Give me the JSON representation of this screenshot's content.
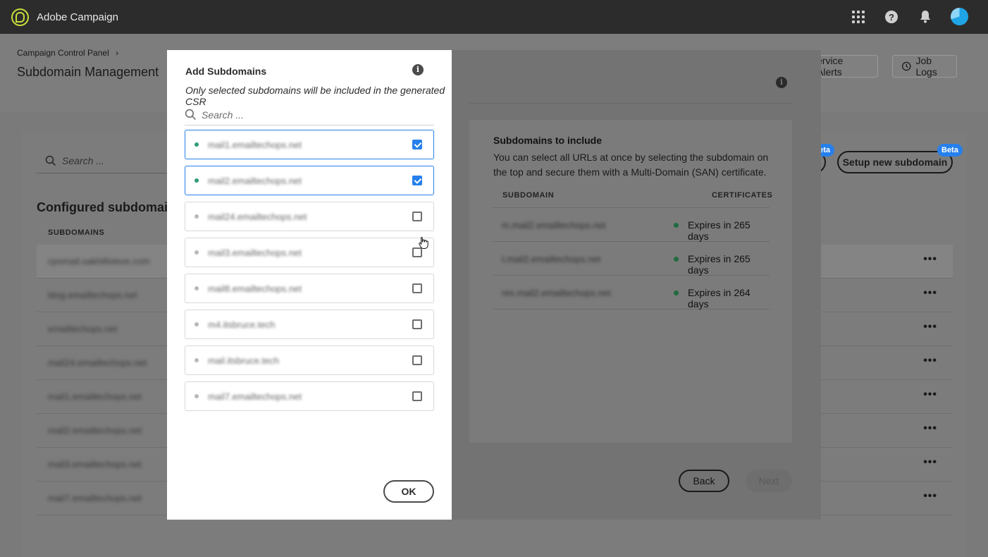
{
  "app": {
    "title": "Adobe Campaign"
  },
  "header": {
    "breadcrumb": "Campaign Control Panel",
    "page_title": "Subdomain Management",
    "service_alerts_label": "ervice Alerts",
    "job_logs_label": "Job Logs"
  },
  "background": {
    "search_placeholder": "Search ...",
    "configured_title": "Configured subdomains",
    "col_subdomains": "SUBDOMAINS",
    "rows": [
      "cpomail.oakhillsteve.com",
      "blog.emailtechops.net",
      "emailtechops.net",
      "mail24.emailtechops.net",
      "mail1.emailtechops.net",
      "mail2.emailtechops.net",
      "mail3.emailtechops.net",
      "mail7.emailtechops.net"
    ],
    "more_label": "•••",
    "setup_label": "Setup new subdomain",
    "beta_label": "Beta",
    "beta_partial_label": "eta"
  },
  "wizard": {
    "include_title": "Subdomains to include",
    "include_desc": "You can select all URLs at once by selecting the subdomain on the top and secure them with a Multi-Domain (SAN) certificate.",
    "col_subdomain": "SUBDOMAIN",
    "col_certificates": "CERTIFICATES",
    "rows": [
      {
        "domain": "m.mail2.emailtechops.net",
        "expires": "Expires in 265 days"
      },
      {
        "domain": "t.mail2.emailtechops.net",
        "expires": "Expires in 265 days"
      },
      {
        "domain": "res.mail2.emailtechops.net",
        "expires": "Expires in 264 days"
      }
    ],
    "back_label": "Back",
    "next_label": "Next"
  },
  "modal": {
    "title": "Add Subdomains",
    "subtitle": "Only selected subdomains will be included in the generated CSR",
    "search_placeholder": "Search ...",
    "options": [
      {
        "name": "mail1.emailtechops.net",
        "checked": true
      },
      {
        "name": "mail2.emailtechops.net",
        "checked": true
      },
      {
        "name": "mail24.emailtechops.net",
        "checked": false
      },
      {
        "name": "mail3.emailtechops.net",
        "checked": false
      },
      {
        "name": "mail8.emailtechops.net",
        "checked": false
      },
      {
        "name": "m4.itsbruce.tech",
        "checked": false
      },
      {
        "name": "mail.itsbruce.tech",
        "checked": false
      },
      {
        "name": "mail7.emailtechops.net",
        "checked": false
      }
    ],
    "ok_label": "OK"
  },
  "colors": {
    "accent": "#2680eb",
    "selected_dot": "#2d9d78",
    "topbar": "#2c2c2c",
    "logo": "#c7dc3a"
  }
}
